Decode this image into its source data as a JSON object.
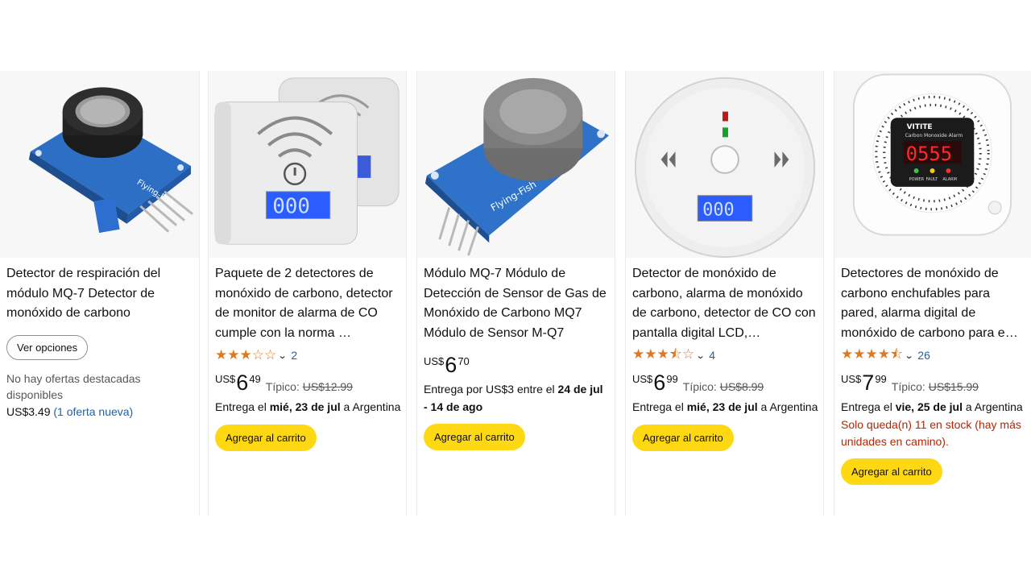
{
  "products": [
    {
      "title": "Detector de respiración del módulo MQ-7 Detector de monóxido de carbono",
      "options_button": "Ver opciones",
      "no_offers": "No hay ofertas destacadas disponibles",
      "used_price": "US$3.49",
      "offers_link": "(1 oferta nueva)",
      "image_icon": "mq7-sensor-module-image"
    },
    {
      "title": "Paquete de 2 detectores de monóxido de carbono, detector de monitor de alarma de CO cumple con la norma …",
      "rating": 3.0,
      "rating_count": "2",
      "price_currency": "US$",
      "price_whole": "6",
      "price_fraction": "49",
      "typical_label": "Típico:",
      "typical_price": "US$12.99",
      "delivery_prefix": "Entrega el",
      "delivery_date": "mié, 23 de jul",
      "delivery_suffix": "a Argentina",
      "cart_button": "Agregar al carrito",
      "image_icon": "plug-in-co-detector-pair-image"
    },
    {
      "title": "Módulo MQ-7 Módulo de Detección de Sensor de Gas de Monóxido de Carbono MQ7 Módulo de Sensor M-Q7",
      "price_currency": "US$",
      "price_whole": "6",
      "price_fraction": "70",
      "delivery_prefix": "Entrega por US$3 entre el",
      "delivery_date": "24 de jul - 14 de ago",
      "cart_button": "Agregar al carrito",
      "image_icon": "mq7-gas-sensor-board-image"
    },
    {
      "title": "Detector de monóxido de carbono, alarma de monóxido de carbono, detector de CO con pantalla digital LCD,…",
      "rating": 3.5,
      "rating_count": "4",
      "price_currency": "US$",
      "price_whole": "6",
      "price_fraction": "99",
      "typical_label": "Típico:",
      "typical_price": "US$8.99",
      "delivery_prefix": "Entrega el",
      "delivery_date": "mié, 23 de jul",
      "delivery_suffix": "a Argentina",
      "cart_button": "Agregar al carrito",
      "image_icon": "round-co-alarm-image"
    },
    {
      "title": "Detectores de monóxido de carbono enchufables para pared, alarma digital de monóxido de carbono para e…",
      "rating": 4.5,
      "rating_count": "26",
      "price_currency": "US$",
      "price_whole": "7",
      "price_fraction": "99",
      "typical_label": "Típico:",
      "typical_price": "US$15.99",
      "delivery_prefix": "Entrega el",
      "delivery_date": "vie, 25 de jul",
      "delivery_suffix": "a Argentina",
      "stock_note": "Solo queda(n) 11 en stock (hay más unidades en camino).",
      "cart_button": "Agregar al carrito",
      "image_icon": "vitite-co-alarm-image",
      "brand_on_image": "VITITE",
      "image_display_text": "Carbon Monoxide Alarm",
      "image_readout": "0555",
      "image_indicator_labels": [
        "POWER",
        "FAULT",
        "ALARM"
      ]
    }
  ],
  "colors": {
    "star": "#de7921",
    "link": "#2162a1",
    "cart_button": "#ffd814",
    "stock_warning": "#b12704",
    "lcd_blue": "#2a5cff"
  }
}
